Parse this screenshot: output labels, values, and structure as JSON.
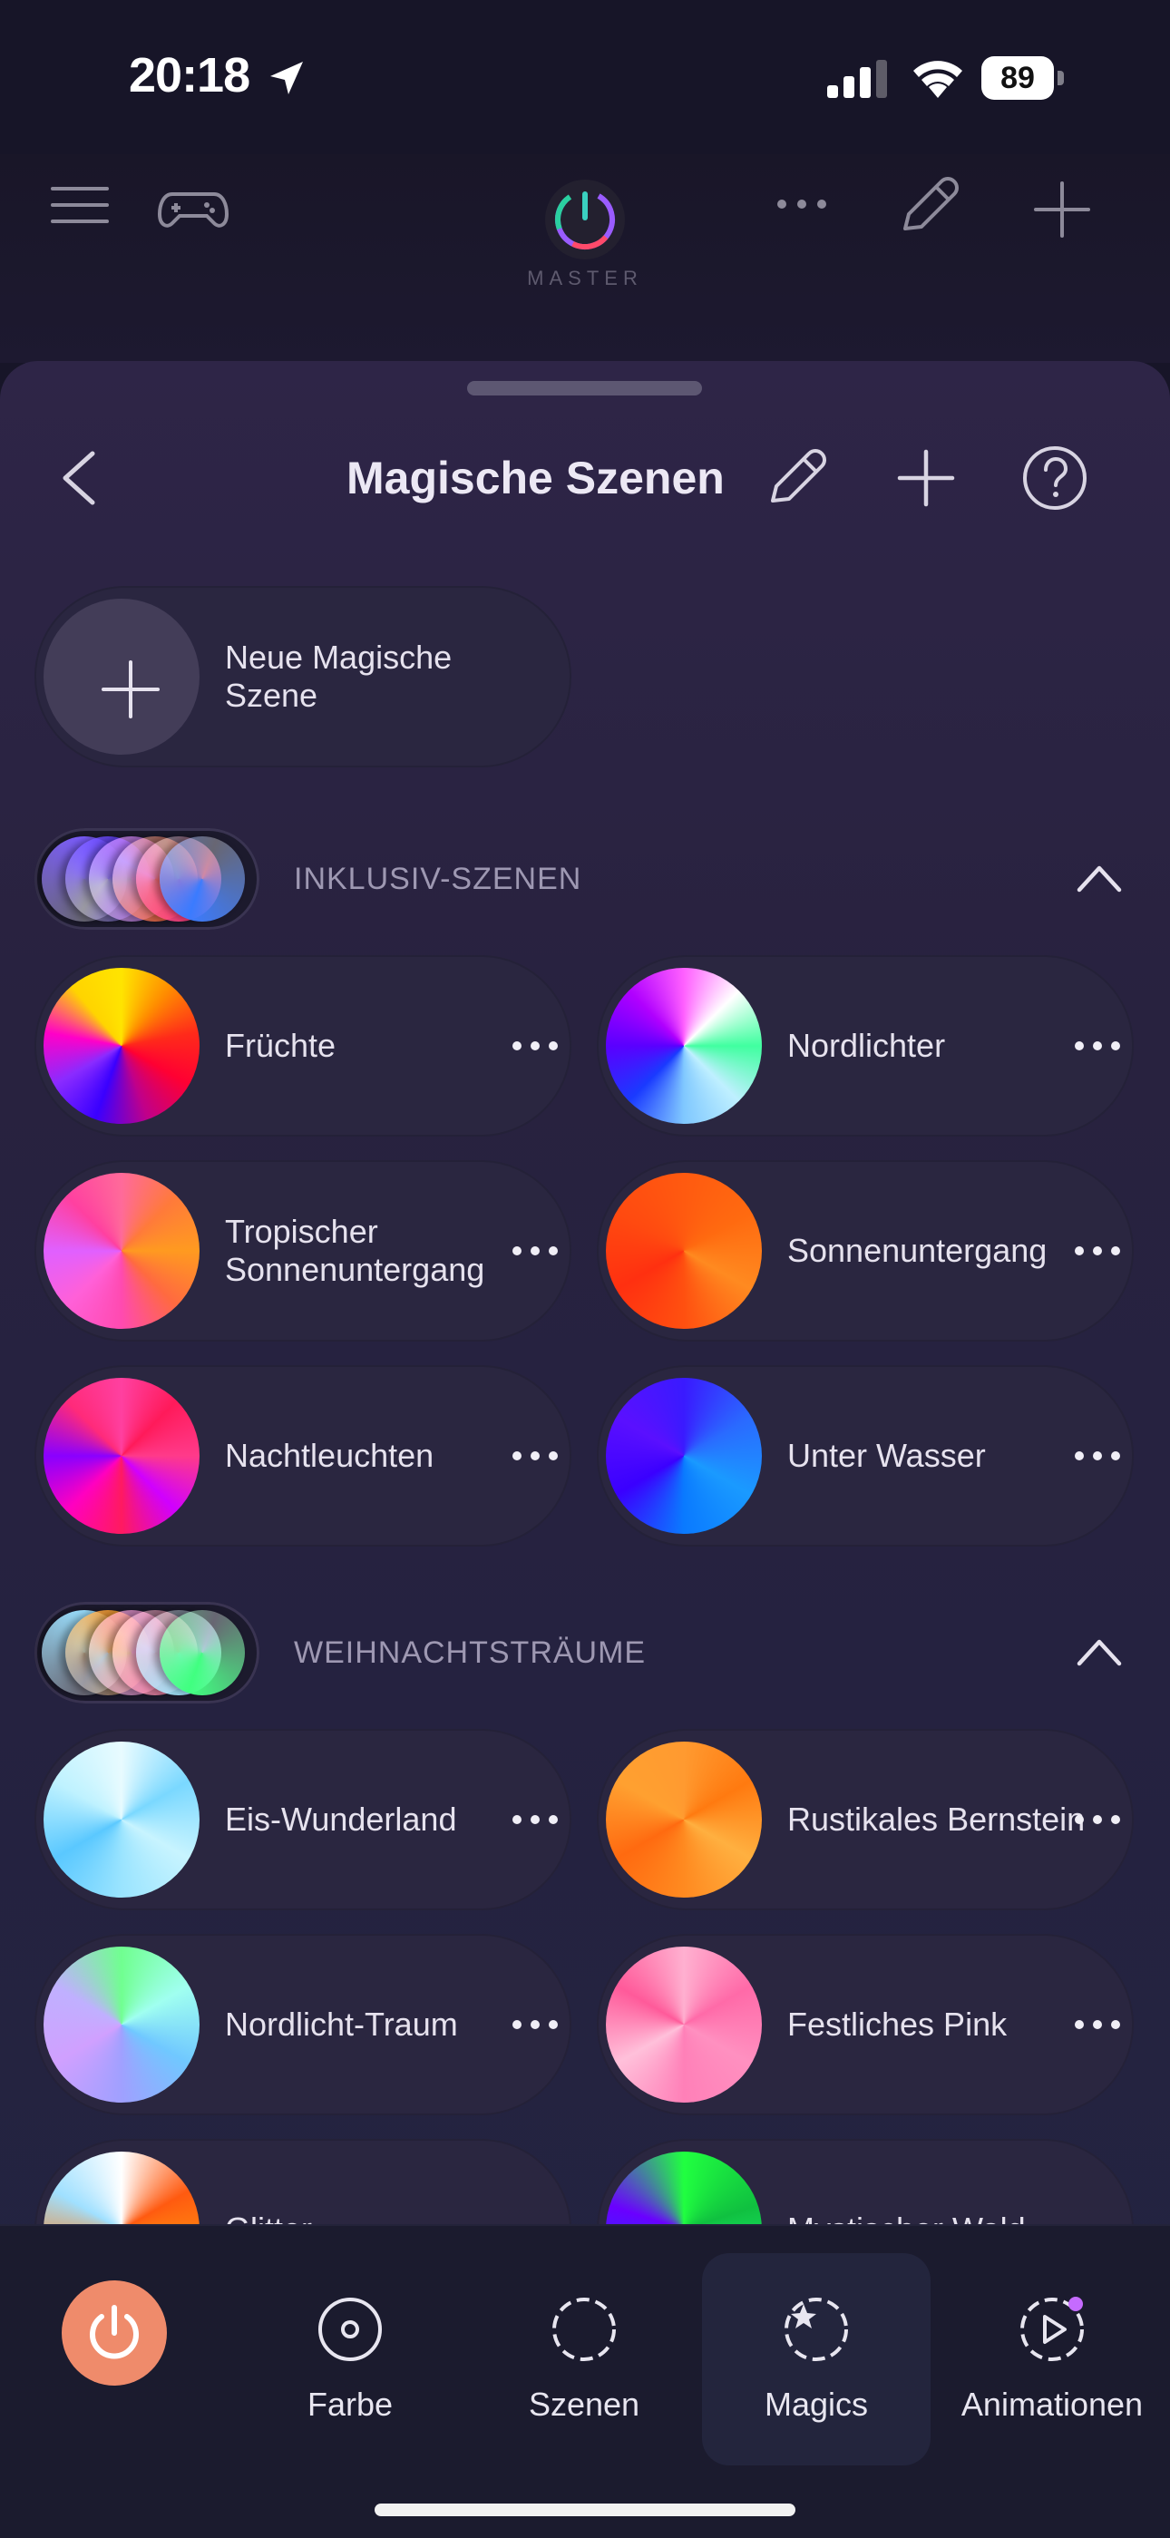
{
  "status_bar": {
    "time": "20:18",
    "battery": "89"
  },
  "top_bar": {
    "master_label": "MASTER"
  },
  "sheet": {
    "title": "Magische Szenen",
    "new_scene_label": "Neue Magische Szene"
  },
  "sections": [
    {
      "title": "INKLUSIV-SZENEN",
      "stack_colors": [
        "#7b5cff",
        "#5a36ff",
        "#d06bff",
        "#ff5a2a",
        "#ff3a7a",
        "#3a7bff"
      ],
      "scenes": [
        {
          "name": "Früchte",
          "gradient": "conic-gradient(from 0deg, #ffe400, #ff8c00, #ff2a1a, #ff0033, #c0008a, #3a00ff, #8a2bff, #ff00c8, #ffd400, #ffe400)"
        },
        {
          "name": "Nordlichter",
          "gradient": "conic-gradient(from 0deg, #ff60ff, #ffffff, #40ffa0, #bff0ff, #80c8ff, #1a3aff, #5a00ff, #b000ff, #ff60ff)"
        },
        {
          "name": "Tropischer Sonnenuntergang",
          "gradient": "conic-gradient(from 0deg, #ff6a9a, #ff7a3a, #ff9a20, #ff6a40, #ff4ab0, #ff60d8, #e060ff, #ff40a0, #ff6a9a)"
        },
        {
          "name": "Sonnenuntergang",
          "gradient": "conic-gradient(from 0deg, #ff5a10, #ff6a10, #ff8a20, #ff5010, #ff3010, #ff4a10, #ff5a10)"
        },
        {
          "name": "Nachtleuchten",
          "gradient": "conic-gradient(from 0deg, #ff40a0, #ff1a5a, #ff3a8a, #d000ff, #ff1a60, #ff00c0, #8a00ff, #ff2a7a, #ff40a0)"
        },
        {
          "name": "Unter Wasser",
          "gradient": "conic-gradient(from 0deg, #3a1aff, #2a6aff, #1a9aff, #0a7aff, #3a00ff, #5a10ff, #3a1aff)"
        }
      ]
    },
    {
      "title": "WEIHNACHTSTRÄUME",
      "stack_colors": [
        "#9ae0ff",
        "#ff9a20",
        "#ff8ad8",
        "#ff7aa0",
        "#a0e8ff",
        "#40ff80"
      ],
      "scenes": [
        {
          "name": "Eis-Wunderland",
          "gradient": "conic-gradient(from 0deg, #e8fbff, #7ad8ff, #c8f4ff, #9ae4ff, #5ac8ff, #bff2ff, #e8fbff)"
        },
        {
          "name": "Rustikales Bernstein",
          "gradient": "conic-gradient(from 0deg, #ff9a30, #ff7a10, #ffb040, #ff8a20, #ff6a10, #ffa030, #ff9a30)"
        },
        {
          "name": "Nordlicht-Traum",
          "gradient": "conic-gradient(from 0deg, #70ff90, #a0fff0, #70c8ff, #a0a0ff, #d0a0ff, #c0b0ff, #70ff90)"
        },
        {
          "name": "Festliches Pink",
          "gradient": "conic-gradient(from 0deg, #ffb0d0, #ff6aa8, #ff90c0, #ff80b8, #ffc0da, #ff5a9a, #ffb0d0)"
        },
        {
          "name": "Glitter",
          "gradient": "conic-gradient(from 0deg, #ffffff, #ff5a10, #ff9a10, #ffb020, #ff7a10, #a0e0ff, #ffffff)"
        },
        {
          "name": "Mystischer Wald",
          "gradient": "conic-gradient(from 0deg, #20ff40, #10c040, #20ff80, #0a4aff, #6a00ff, #20ff40)"
        }
      ]
    }
  ],
  "tabbar": {
    "tabs": [
      {
        "label": "Farbe"
      },
      {
        "label": "Szenen"
      },
      {
        "label": "Magics"
      },
      {
        "label": "Animationen"
      }
    ],
    "accent": "#ef8b6b",
    "active_tab": "Magics"
  }
}
